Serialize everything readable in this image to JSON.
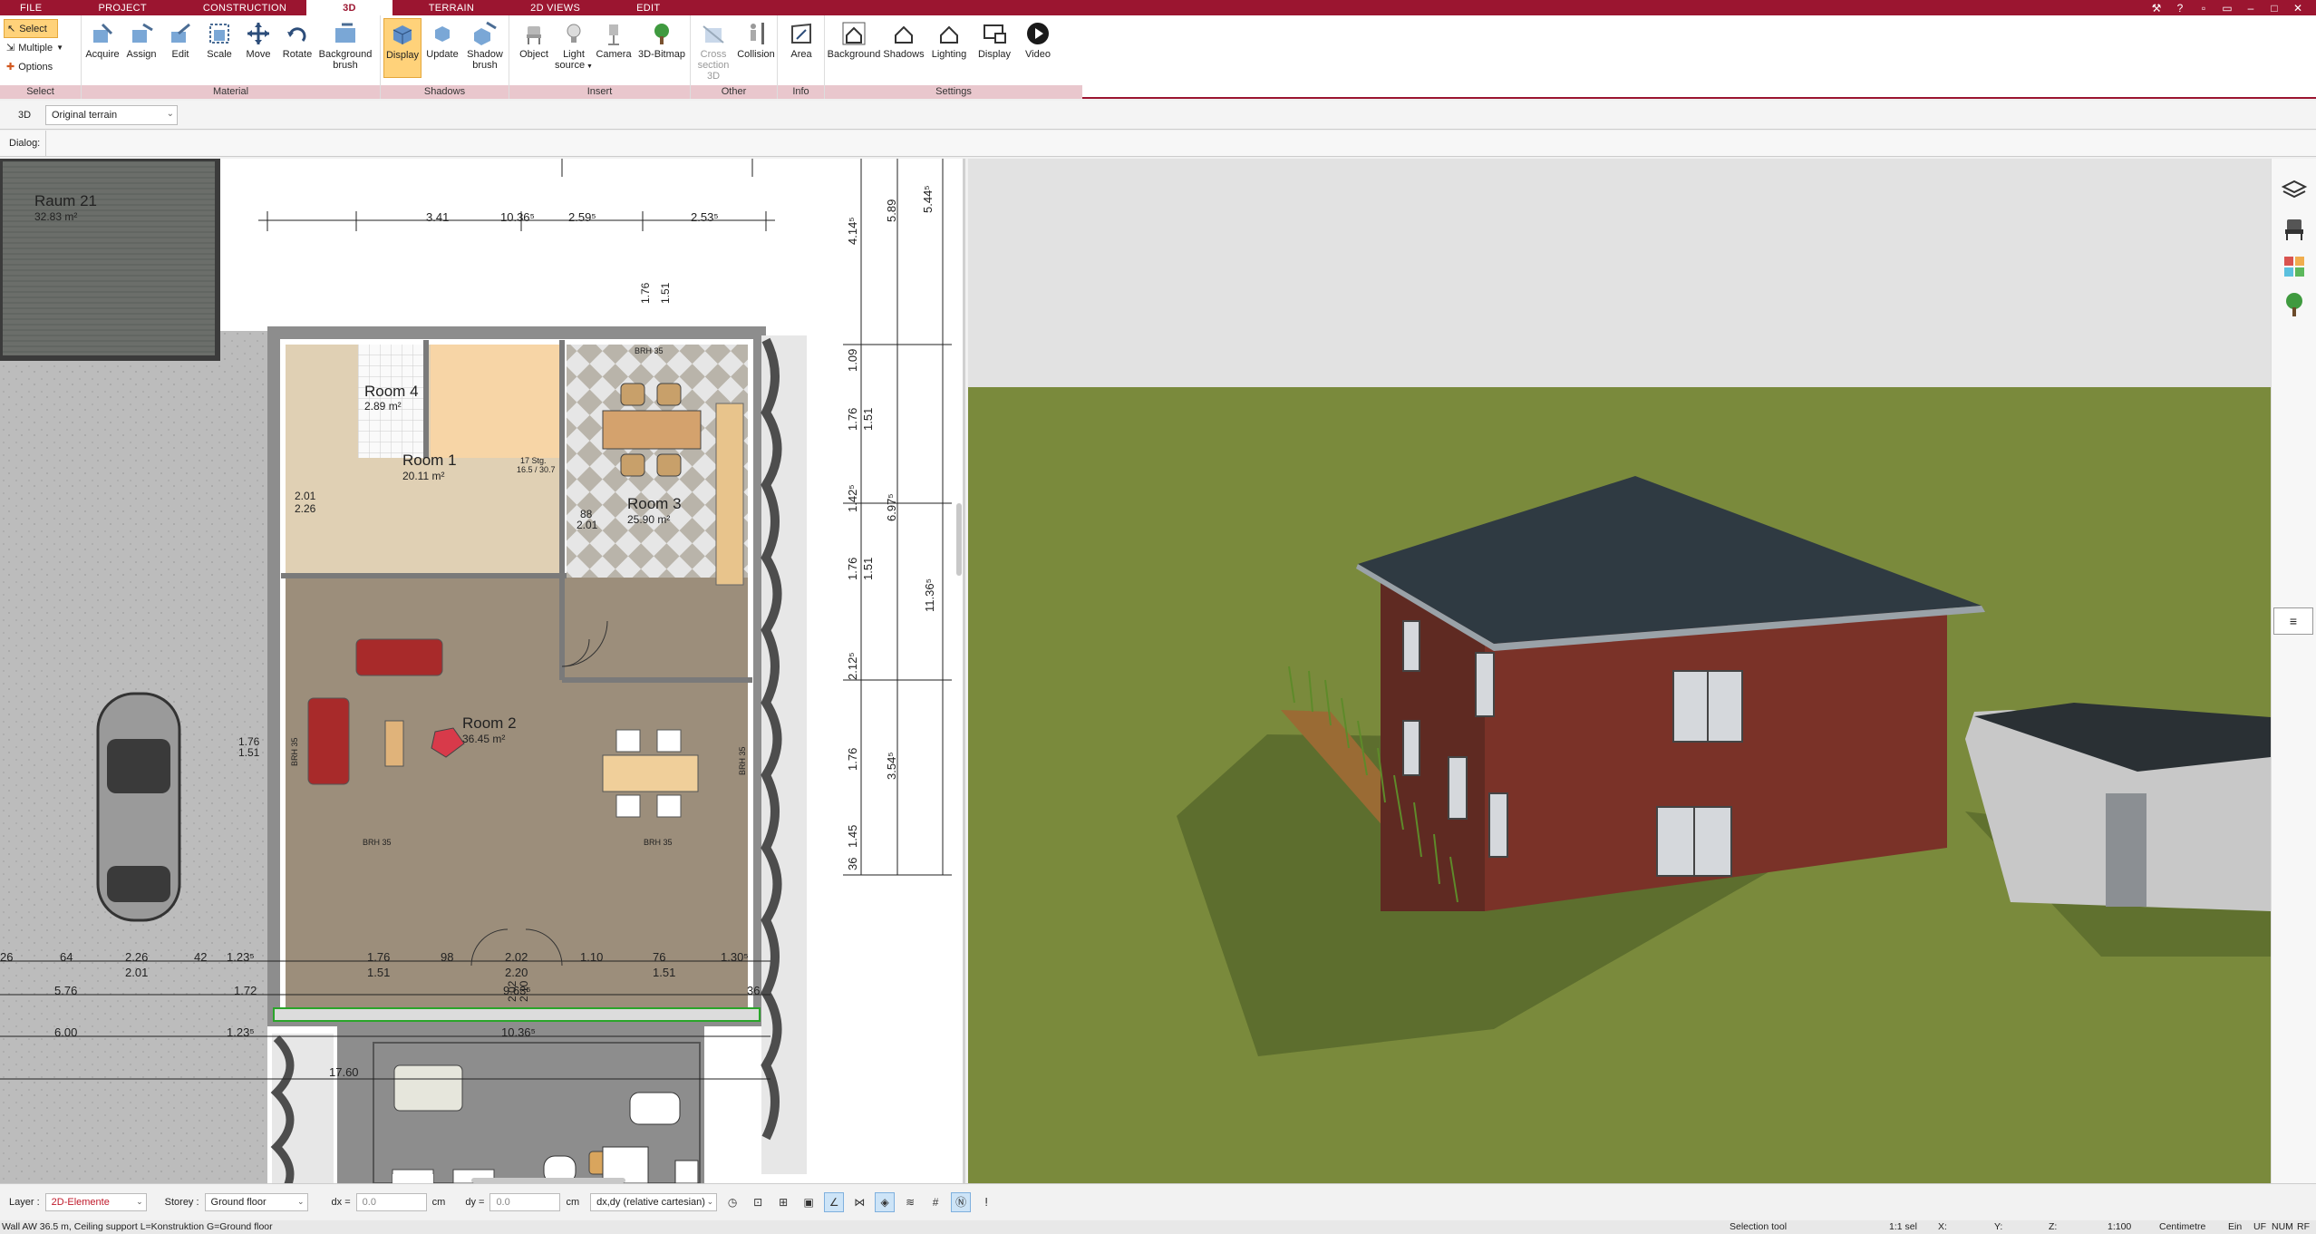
{
  "tabs": [
    {
      "label": "FILE",
      "active": false
    },
    {
      "label": "PROJECT",
      "active": false
    },
    {
      "label": "CONSTRUCTION",
      "active": false
    },
    {
      "label": "3D",
      "active": true
    },
    {
      "label": "TERRAIN",
      "active": false
    },
    {
      "label": "2D VIEWS",
      "active": false
    },
    {
      "label": "EDIT",
      "active": false
    }
  ],
  "ribbon": {
    "select_group": {
      "select": "Select",
      "multiple": "Multiple",
      "options": "Options",
      "label": "Select"
    },
    "material": {
      "label": "Material",
      "acquire": "Acquire",
      "assign": "Assign",
      "edit": "Edit",
      "scale": "Scale",
      "move": "Move",
      "rotate": "Rotate",
      "background_brush_1": "Background",
      "background_brush_2": "brush"
    },
    "shadows": {
      "label": "Shadows",
      "display": "Display",
      "update": "Update",
      "shadow_brush_1": "Shadow",
      "shadow_brush_2": "brush"
    },
    "insert": {
      "label": "Insert",
      "object": "Object",
      "light_source_1": "Light",
      "light_source_2": "source",
      "camera": "Camera",
      "bitmap": "3D-Bitmap"
    },
    "other": {
      "label": "Other",
      "cross_section_1": "Cross",
      "cross_section_2": "section 3D",
      "collision": "Collision"
    },
    "info": {
      "label": "Info",
      "area": "Area"
    },
    "settings": {
      "label": "Settings",
      "background": "Background",
      "shadows": "Shadows",
      "lighting": "Lighting",
      "display": "Display",
      "video": "Video"
    }
  },
  "subbar": {
    "label": "3D",
    "terrain_value": "Original terrain"
  },
  "dialog": {
    "label": "Dialog:"
  },
  "plan": {
    "rooms": [
      {
        "name": "Raum 21",
        "area": "32.83 m²"
      },
      {
        "name": "Room 4",
        "area": "2.89 m²"
      },
      {
        "name": "Room 1",
        "area": "20.11 m²"
      },
      {
        "name": "Room 3",
        "area": "25.90 m²"
      },
      {
        "name": "Room 2",
        "area": "36.45 m²"
      }
    ],
    "top_dims": [
      "3.41",
      "10.36⁵",
      "2.59⁵",
      "2.53⁵"
    ],
    "bottom_dims": [
      "26",
      "64",
      "2.26",
      "42",
      "1.23⁵",
      "1.76",
      "98",
      "2.02",
      "1.10",
      "76",
      "1.30⁵"
    ],
    "bottom_dims_2": [
      "2.01",
      "1.51",
      "2.20",
      "1.51"
    ],
    "bottom_rows": [
      "5.76",
      "1.72",
      "9.63⁵",
      "36",
      "6.00",
      "1.23⁵",
      "10.36⁵",
      "17.60"
    ],
    "right_dims": [
      "5.89",
      "5.44⁵",
      "4.14⁵",
      "1.09",
      "1.76",
      "1.51",
      "1.42⁵",
      "6.97⁵",
      "1.76",
      "1.51",
      "11.36⁵",
      "2.12⁵",
      "1.76",
      "3.54⁵",
      "1.45",
      "36"
    ],
    "misc_labels": [
      "BRH 35",
      "BRH 35",
      "BRH 35",
      "BRH 35",
      "BRH 35",
      "17 Stg.",
      "16.5 / 30.7",
      "2.01",
      "2.26",
      "88",
      "2.01",
      "1.76",
      "1.51",
      "2.02",
      "2.10",
      "1.76",
      "1.51"
    ]
  },
  "status": {
    "layer_label": "Layer :",
    "layer_value": "2D-Elemente",
    "storey_label": "Storey :",
    "storey_value": "Ground floor",
    "dx_label": "dx =",
    "dx_value": "0.0",
    "dy_label": "dy =",
    "dy_value": "0.0",
    "unit": "cm",
    "coord_mode": "dx,dy (relative cartesian)"
  },
  "info": {
    "left": "Wall AW 36.5 m, Ceiling support L=Konstruktion G=Ground floor",
    "tool": "Selection tool",
    "sel": "1:1 sel",
    "x": "X:",
    "y": "Y:",
    "z": "Z:",
    "scale": "1:100",
    "unit": "Centimetre",
    "ein": "Ein",
    "uf": "UF",
    "num": "NUM",
    "rf": "RF"
  },
  "colors": {
    "brand": "#9b1530",
    "ribbon_label": "#e9c7cd",
    "active_tool": "#ffd27a",
    "grass": "#7a8a3c",
    "brick": "#7a3228",
    "roof": "#2f3a42"
  },
  "icons": {
    "win": [
      "tools-icon",
      "help-icon",
      "settings-icon",
      "restore-icon",
      "minimize-icon",
      "maximize-icon",
      "close-icon"
    ],
    "right": [
      "layers-icon",
      "chair-icon",
      "palette-icon",
      "tree-icon"
    ]
  }
}
